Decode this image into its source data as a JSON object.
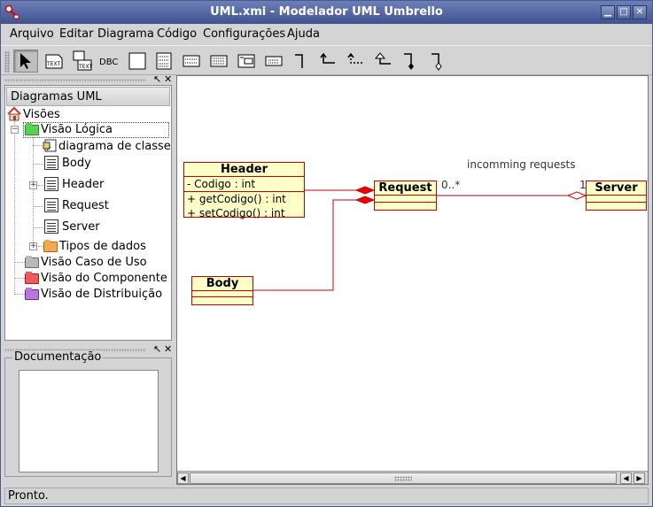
{
  "window": {
    "title": "UML.xmi - Modelador UML Umbrello",
    "controls": {
      "minimize": "▁",
      "maximize": "□",
      "close": "✕"
    }
  },
  "menu": [
    "Arquivo",
    "Editar",
    "Diagrama",
    "Código",
    "Configurações",
    "Ajuda"
  ],
  "toolbar": {
    "tools": [
      {
        "name": "select-arrow-tool",
        "icon": "arrow-cursor-icon",
        "active": true
      },
      {
        "name": "text-note-tool",
        "icon": "text-note-icon",
        "label": "TEXT"
      },
      {
        "name": "text-box-tool",
        "icon": "text-box-icon",
        "label": "TEXT"
      },
      {
        "name": "dbc-tool",
        "icon": "dbc-icon",
        "label": "DBC"
      },
      {
        "name": "box-tool",
        "icon": "box-icon"
      },
      {
        "name": "class-tool",
        "icon": "class-icon"
      },
      {
        "name": "interface-tool",
        "icon": "interface-icon"
      },
      {
        "name": "datatype-tool",
        "icon": "datatype-icon"
      },
      {
        "name": "enum-tool",
        "icon": "enum-icon"
      },
      {
        "name": "package-tool",
        "icon": "package-icon"
      },
      {
        "name": "association-tool",
        "icon": "association-icon"
      },
      {
        "name": "directional-association-tool",
        "icon": "directional-association-icon"
      },
      {
        "name": "dependency-tool",
        "icon": "dependency-icon"
      },
      {
        "name": "generalization-tool",
        "icon": "generalization-icon"
      },
      {
        "name": "composition-tool",
        "icon": "composition-icon"
      },
      {
        "name": "aggregation-tool",
        "icon": "aggregation-icon"
      }
    ]
  },
  "tree": {
    "header": "Diagramas UML",
    "root": "Visões",
    "logical_view": "Visão Lógica",
    "items": [
      {
        "label": "diagrama de classe",
        "icon": "class-diagram-icon"
      },
      {
        "label": "Body",
        "icon": "class-icon"
      },
      {
        "label": "Header",
        "icon": "class-icon"
      },
      {
        "label": "Request",
        "icon": "class-icon"
      },
      {
        "label": "Server",
        "icon": "class-icon"
      },
      {
        "label": "Tipos de dados",
        "icon": "folder-icon"
      }
    ],
    "other_views": [
      {
        "label": "Visão Caso de Uso",
        "color": "#9a9a9a"
      },
      {
        "label": "Visão do Componente",
        "color": "#e23b3b"
      },
      {
        "label": "Visão de Distribuição",
        "color": "#a35ad0"
      }
    ]
  },
  "documentation": {
    "label": "Documentação",
    "text": ""
  },
  "diagram": {
    "classes": {
      "header": {
        "name": "Header",
        "attributes": [
          "- Codigo : int"
        ],
        "operations": [
          "+ getCodigo() : int",
          "+ setCodigo() : int"
        ]
      },
      "request": {
        "name": "Request"
      },
      "server": {
        "name": "Server"
      },
      "body": {
        "name": "Body"
      }
    },
    "association_label": "incomming requests",
    "multiplicity_request": "0..*",
    "multiplicity_server": "1"
  },
  "status": "Pronto.",
  "colors": {
    "class_fill": "#ffffc8",
    "class_border": "#cc0000",
    "titlebar": "#4d5e99"
  }
}
